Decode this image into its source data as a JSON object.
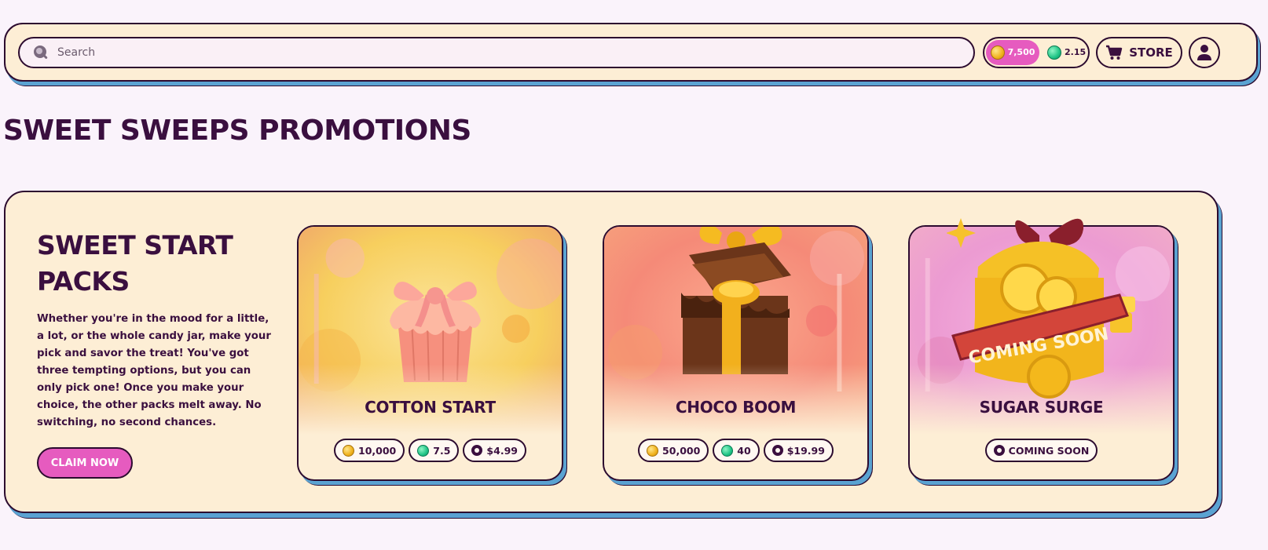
{
  "header": {
    "search": {
      "placeholder": "Search"
    },
    "balance": {
      "gold_coins": "7,500",
      "sweeps_coins": "2.15"
    },
    "store_label": "STORE"
  },
  "page_title": "SWEET SWEEPS PROMOTIONS",
  "promo": {
    "heading": "SWEET START PACKS",
    "description": "Whether you're in the mood for a little, a lot, or the whole candy jar, make your pick and savor the treat! You've got three tempting options, but you can only pick one! Once you make your choice, the other packs melt away. No switching, no second chances.",
    "claim_label": "CLAIM NOW",
    "packs": [
      {
        "name": "COTTON START",
        "gold": "10,000",
        "sweeps": "7.5",
        "price": "$4.99",
        "icon": "cupcake-gift-icon"
      },
      {
        "name": "CHOCO BOOM",
        "gold": "50,000",
        "sweeps": "40",
        "price": "$19.99",
        "icon": "chocolate-gift-box-icon"
      },
      {
        "name": "SUGAR SURGE",
        "status": "COMING SOON",
        "banner": "COMING SOON",
        "icon": "treasure-chest-icon"
      }
    ]
  },
  "colors": {
    "accent_pink": "#e65bbf",
    "panel": "#fdeed5",
    "outline": "#2c0b2f",
    "shadow_blue": "#5aa3d2"
  }
}
